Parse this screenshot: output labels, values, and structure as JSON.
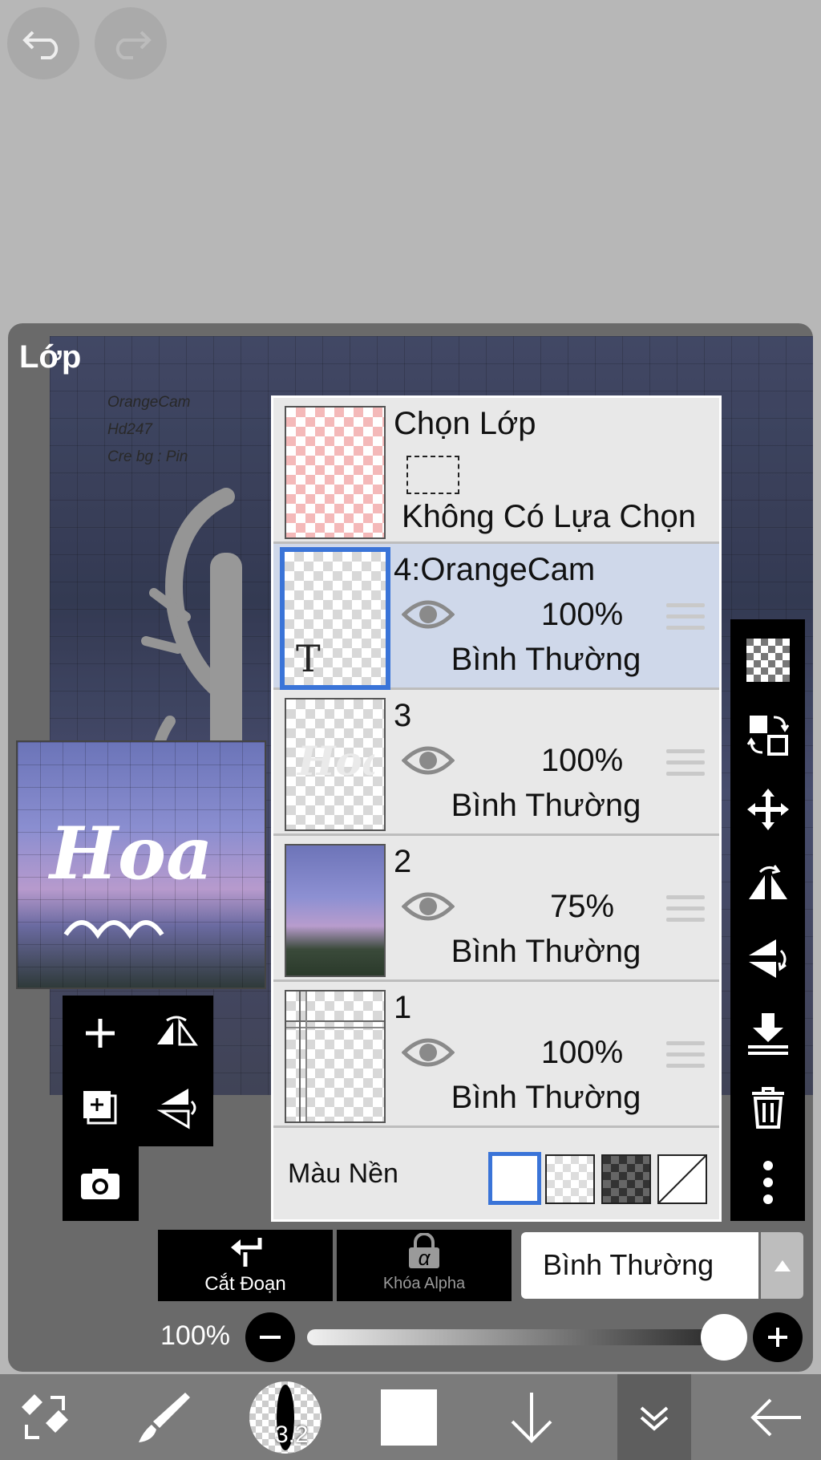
{
  "top": {
    "undo_icon": "undo-icon",
    "redo_icon": "redo-icon"
  },
  "panel": {
    "title": "Lớp"
  },
  "canvas": {
    "credits": [
      "OrangeCam",
      "Hd247",
      "Cre bg : Pin"
    ]
  },
  "selection": {
    "title": "Chọn Lớp",
    "status": "Không Có Lựa Chọn"
  },
  "layers": [
    {
      "name": "4:OrangeCam",
      "opacity": "100%",
      "blend": "Bình Thường",
      "selected": true,
      "type_badge": "T"
    },
    {
      "name": "3",
      "opacity": "100%",
      "blend": "Bình Thường",
      "selected": false
    },
    {
      "name": "2",
      "opacity": "75%",
      "blend": "Bình Thường",
      "selected": false
    },
    {
      "name": "1",
      "opacity": "100%",
      "blend": "Bình Thường",
      "selected": false
    }
  ],
  "background": {
    "label": "Màu Nền",
    "options": [
      "white",
      "checker",
      "dark-checker",
      "none"
    ],
    "selected": "white"
  },
  "actions": {
    "clip_label": "Cắt Đoạn",
    "alpha_lock_label": "Khóa Alpha",
    "alpha_symbol": "α",
    "blend_mode": "Bình Thường"
  },
  "opacity_slider": {
    "label": "100%",
    "value": 1.0
  },
  "bottom_toolbar": {
    "brush_size": "3.2"
  },
  "colors": {
    "accent": "#3a74d8",
    "selected_row": "#cfd8ea",
    "panel_bg": "#e8e8e8"
  }
}
